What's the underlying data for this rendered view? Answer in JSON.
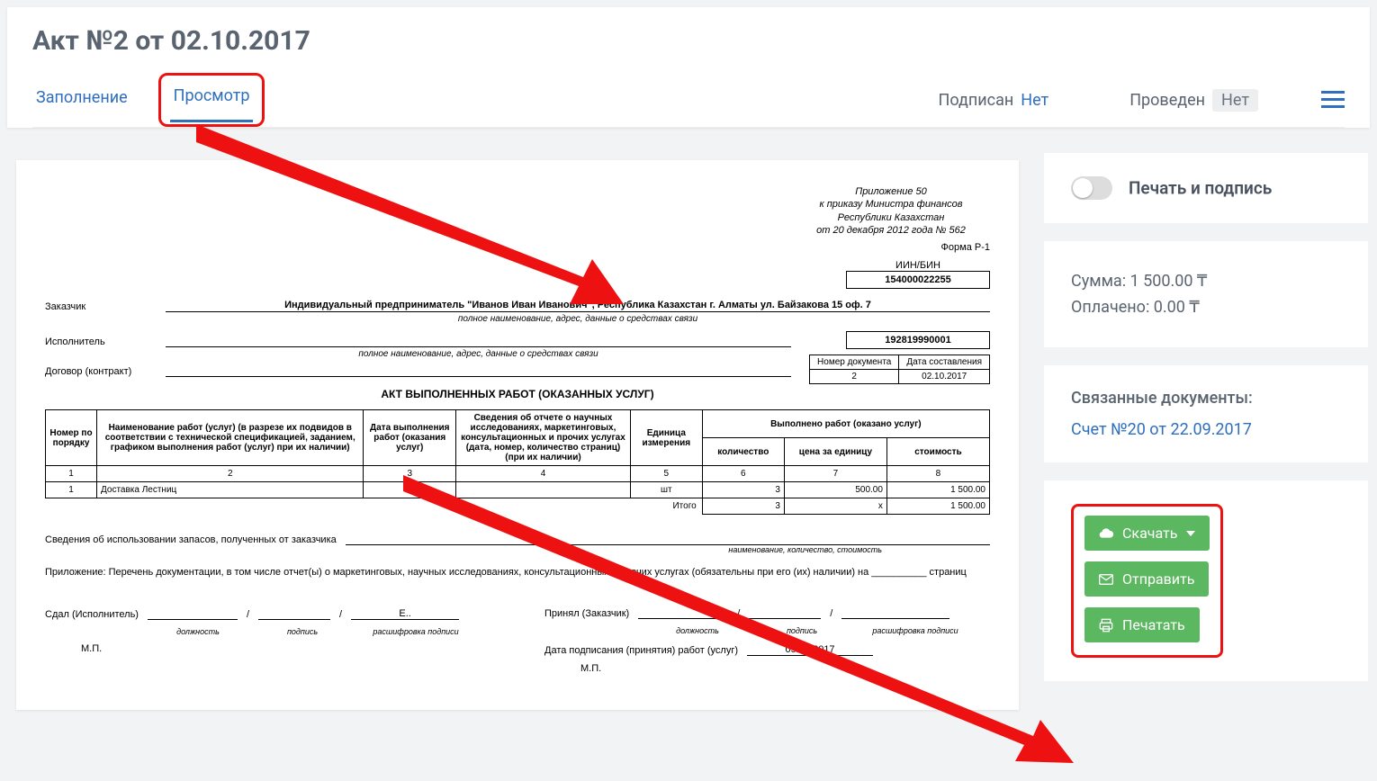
{
  "header": {
    "title": "Акт №2 от 02.10.2017",
    "tabs": {
      "fill": "Заполнение",
      "view": "Просмотр"
    },
    "signed_label": "Подписан",
    "signed_value": "Нет",
    "posted_label": "Проведен",
    "posted_value": "Нет"
  },
  "sidebar": {
    "toggle_label": "Печать и подпись",
    "sum_label": "Сумма:",
    "sum_value": "1 500.00 ₸",
    "paid_label": "Оплачено:",
    "paid_value": "0.00 ₸",
    "related_title": "Связанные документы:",
    "related_link": "Счет №20 от 22.09.2017",
    "buttons": {
      "download": "Скачать",
      "send": "Отправить",
      "print": "Печатать"
    }
  },
  "doc": {
    "appendix": "Приложение 50\nк приказу Министра финансов\nРеспублики Казахстан\nот 20 декабря 2012 года № 562",
    "form_code": "Форма Р-1",
    "iin_label": "ИИН/БИН",
    "iin_customer": "154000022255",
    "iin_executor": "192819990001",
    "customer_label": "Заказчик",
    "customer_value": "Индивидуальный предприниматель \"Иванов Иван Иванович\", Республика Казахстан г. Алматы ул. Байзакова 15 оф. 7",
    "field_caption": "полное наименование, адрес, данные о средствах связи",
    "executor_label": "Исполнитель",
    "executor_value": "",
    "contract_label": "Договор (контракт)",
    "mini_headers": {
      "num": "Номер документа",
      "date": "Дата составления"
    },
    "mini_values": {
      "num": "2",
      "date": "02.10.2017"
    },
    "act_title": "АКТ ВЫПОЛНЕННЫХ РАБОТ (ОКАЗАННЫХ УСЛУГ)",
    "cols": {
      "c1": "Номер по порядку",
      "c2": "Наименование работ (услуг) (в разрезе их подвидов в соответствии с технической спецификацией, заданием, графиком выполнения работ (услуг) при их наличии)",
      "c3": "Дата выполнения работ (оказания услуг)",
      "c4": "Сведения об отчете о научных исследованиях, маркетинговых, консультационных и прочих услугах (дата, номер, количество страниц) (при их наличии)",
      "c5": "Единица измерения",
      "group": "Выполнено работ (оказано услуг)",
      "c6": "количество",
      "c7": "цена за единицу",
      "c8": "стоимость"
    },
    "nums": [
      "1",
      "2",
      "3",
      "4",
      "5",
      "6",
      "7",
      "8"
    ],
    "row": {
      "n": "1",
      "name": "Доставка Лестниц",
      "date": "",
      "info": "",
      "unit": "шт",
      "qty": "3",
      "price": "500.00",
      "sum": "1 500.00"
    },
    "total_label": "Итого",
    "total_qty": "3",
    "total_price": "х",
    "total_sum": "1 500.00",
    "stock_info": "Сведения об использовании запасов, полученных от заказчика",
    "stock_caption": "наименование, количество, стоимость",
    "attach": "Приложение: Перечень документации, в том числе отчет(ы) о маркетинговых, научных исследованиях, консультационных и прочих услугах (обязательны при его (их) наличии) на __________ страниц",
    "gave_label": "Сдал (Исполнитель)",
    "took_label": "Принял (Заказчик)",
    "pos": "должность",
    "sign": "подпись",
    "decode": "расшифровка подписи",
    "decode_short": "Е..",
    "mp": "М.П.",
    "accept_date_label": "Дата подписания (принятия) работ (услуг)",
    "accept_date": "05.09.2017"
  }
}
